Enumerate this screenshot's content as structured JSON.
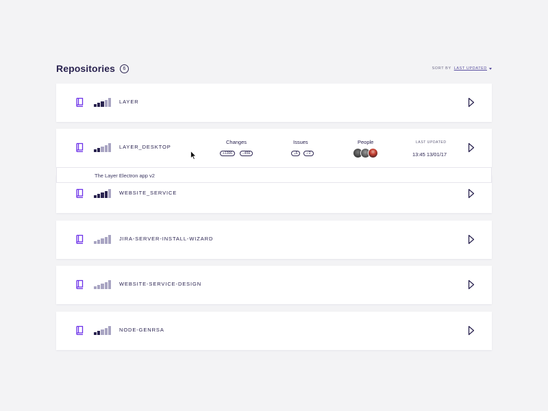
{
  "header": {
    "title": "Repositories",
    "count": "6",
    "sort_label": "SORT BY",
    "sort_value": "LAST UPDATED"
  },
  "colors": {
    "accent": "#6a2ee8",
    "text": "#2a2350",
    "bar_dark": "#2a2350",
    "bar_light": "#a8a4c2"
  },
  "repos": [
    {
      "name": "LAYER",
      "signal": 3
    },
    {
      "name": "LAYER_DESKTOP",
      "signal": 2,
      "changes_label": "Changes",
      "changes_add": "+1306",
      "changes_del": "−456",
      "issues_label": "Issues",
      "issues_open": "6",
      "issues_closed": "2",
      "people_label": "People",
      "last_updated_label": "LAST UPDATED",
      "last_updated_value": "13:45 13/01/17",
      "description": "The Layer Electron app v2"
    },
    {
      "name": "WEBSITE_SERVICE",
      "signal": 4
    },
    {
      "name": "JIRA-SERVER-INSTALL-WIZARD",
      "signal": 0
    },
    {
      "name": "WEBSITE-SERVICE-DESIGN",
      "signal": 0
    },
    {
      "name": "NODE-GENRSA",
      "signal": 2
    }
  ],
  "icons": {
    "repo": "book-icon",
    "open": "chevron-right-icon",
    "cursor": "mouse-cursor-icon"
  }
}
